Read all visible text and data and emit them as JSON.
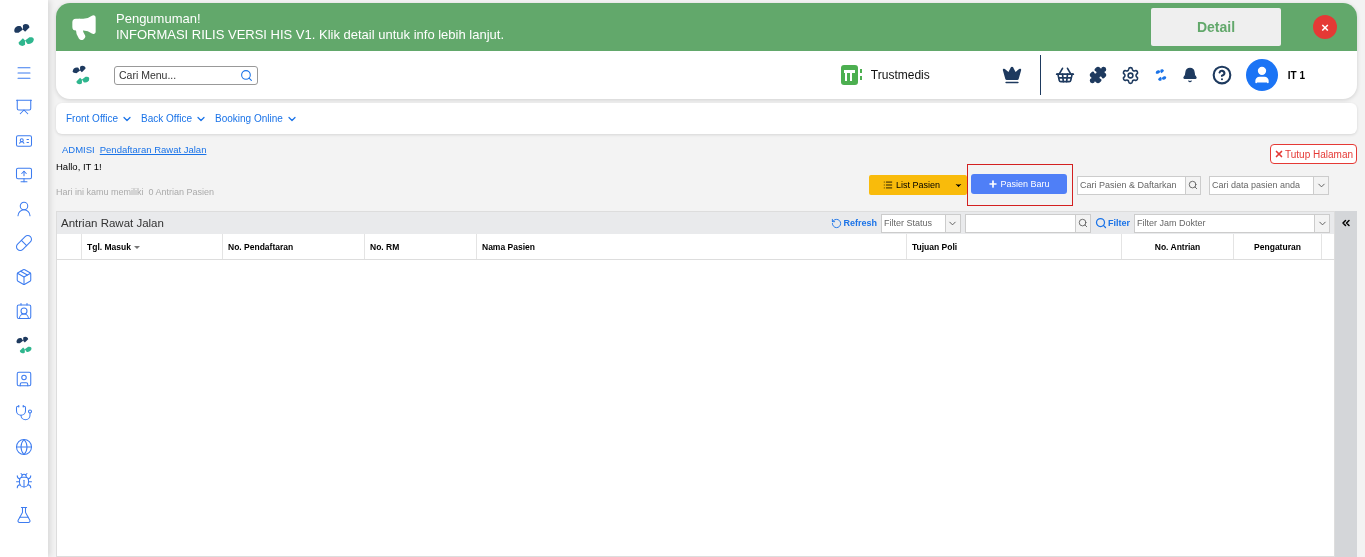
{
  "announcement": {
    "title": "Pengumuman!",
    "message": "INFORMASI RILIS VERSI HIS V1. Klik detail untuk info lebih lanjut.",
    "detail_button": "Detail",
    "close_button": "×"
  },
  "header": {
    "search": {
      "placeholder": "Cari Menu..."
    },
    "brand": "Trustmedis",
    "user": "IT 1"
  },
  "nav": [
    {
      "label": "Front Office"
    },
    {
      "label": "Back Office"
    },
    {
      "label": "Booking Online"
    }
  ],
  "breadcrumb": [
    {
      "label": "ADMISI",
      "selected": false
    },
    {
      "label": "Pendaftaran Rawat Jalan",
      "selected": true
    }
  ],
  "close_page": "Tutup Halaman",
  "greeting": "Hallo, IT 1!",
  "queue_note": "Hari ini kamu memiliki  0 Antrian Pasien",
  "actions": {
    "list_button": "List Pasien",
    "new_button": "Pasien Baru",
    "search_register": {
      "placeholder": "Cari Pasien & Daftarkan"
    },
    "search_data": {
      "placeholder": "Cari data pasien anda"
    }
  },
  "table": {
    "title": "Antrian Rawat Jalan",
    "refresh": "Refresh",
    "filter_status": {
      "placeholder": "Filter Status"
    },
    "filter_label": "Filter",
    "filter_doctor": {
      "placeholder": "Filter Jam Dokter"
    },
    "columns": [
      {
        "label": "Tgl. Masuk",
        "sorted": true
      },
      {
        "label": "No. Pendaftaran",
        "sorted": false
      },
      {
        "label": "No. RM",
        "sorted": false
      },
      {
        "label": "Nama Pasien",
        "sorted": false
      },
      {
        "label": "Tujuan Poli",
        "sorted": false
      },
      {
        "label": "No. Antrian",
        "sorted": false
      },
      {
        "label": "Pengaturan",
        "sorted": false
      }
    ]
  }
}
